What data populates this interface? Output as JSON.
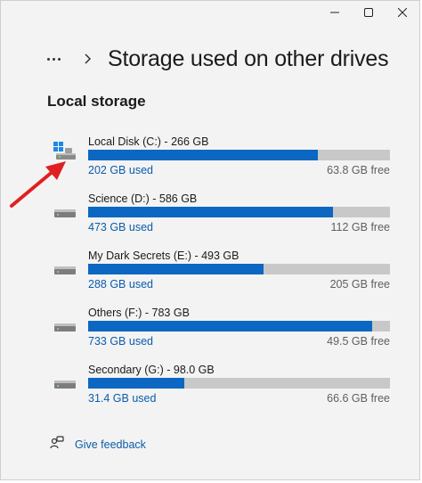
{
  "window": {
    "controls": [
      "minimize",
      "maximize",
      "close"
    ]
  },
  "header": {
    "title": "Storage used on other drives",
    "icons": [
      "more-icon",
      "chevron-right-icon"
    ]
  },
  "section": {
    "title": "Local storage"
  },
  "drives": [
    {
      "name": "Local Disk (C:) - 266 GB",
      "used": "202 GB used",
      "free": "63.8 GB free",
      "used_fraction": 0.76,
      "icon": "windows-drive-icon"
    },
    {
      "name": "Science (D:) - 586 GB",
      "used": "473 GB used",
      "free": "112 GB free",
      "used_fraction": 0.81,
      "icon": "drive-icon"
    },
    {
      "name": "My Dark Secrets (E:) - 493 GB",
      "used": "288 GB used",
      "free": "205 GB free",
      "used_fraction": 0.58,
      "icon": "drive-icon"
    },
    {
      "name": "Others (F:) - 783 GB",
      "used": "733 GB used",
      "free": "49.5 GB free",
      "used_fraction": 0.94,
      "icon": "drive-icon"
    },
    {
      "name": "Secondary (G:) - 98.0 GB",
      "used": "31.4 GB used",
      "free": "66.6 GB free",
      "used_fraction": 0.32,
      "icon": "drive-icon"
    }
  ],
  "feedback": {
    "label": "Give feedback",
    "icon": "feedback-icon"
  },
  "colors": {
    "accent": "#0b67c2",
    "bar_track": "#c8c8c8",
    "annotation_arrow": "#e02020"
  }
}
